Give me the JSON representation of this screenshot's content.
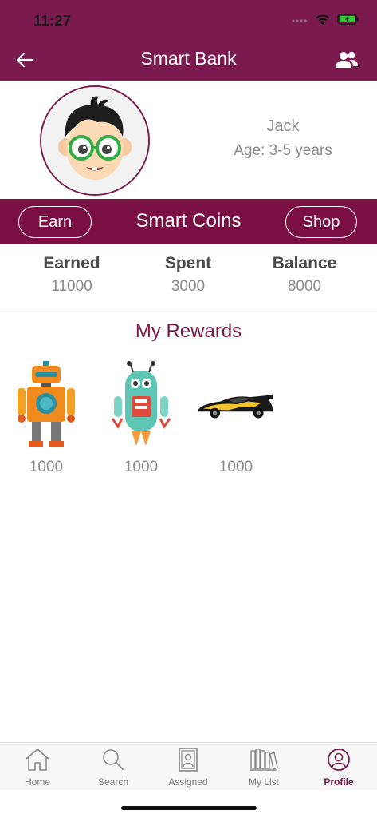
{
  "status": {
    "time": "11:27"
  },
  "nav": {
    "title": "Smart Bank"
  },
  "profile": {
    "name": "Jack",
    "age": "Age: 3-5 years"
  },
  "coins": {
    "title": "Smart Coins",
    "earn_label": "Earn",
    "shop_label": "Shop"
  },
  "stats": [
    {
      "label": "Earned",
      "value": "11000"
    },
    {
      "label": "Spent",
      "value": "3000"
    },
    {
      "label": "Balance",
      "value": "8000"
    }
  ],
  "rewards": {
    "title": "My Rewards",
    "items": [
      {
        "icon": "orange-robot",
        "value": "1000"
      },
      {
        "icon": "teal-robot",
        "value": "1000"
      },
      {
        "icon": "race-car",
        "value": "1000"
      }
    ]
  },
  "tabs": [
    {
      "label": "Home",
      "icon": "home-icon"
    },
    {
      "label": "Search",
      "icon": "search-icon"
    },
    {
      "label": "Assigned",
      "icon": "assigned-icon"
    },
    {
      "label": "My List",
      "icon": "books-icon"
    },
    {
      "label": "Profile",
      "icon": "profile-icon",
      "active": true
    }
  ],
  "colors": {
    "brand": "#7a1a4e",
    "coin_bar": "#7a0f44",
    "muted_text": "#8a8a8a",
    "battery": "#3cc63c"
  }
}
